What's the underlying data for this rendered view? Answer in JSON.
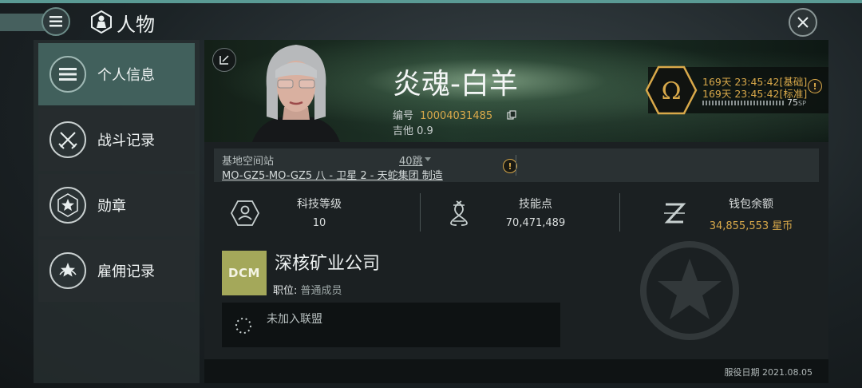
{
  "header": {
    "title": "人物"
  },
  "sidebar": {
    "items": [
      {
        "label": "个人信息",
        "icon": "list-icon",
        "active": true
      },
      {
        "label": "战斗记录",
        "icon": "crossed-swords-icon",
        "active": false
      },
      {
        "label": "勋章",
        "icon": "star-badge-icon",
        "active": false
      },
      {
        "label": "雇佣记录",
        "icon": "star-laurel-icon",
        "active": false
      }
    ]
  },
  "character": {
    "name": "炎魂-白羊",
    "id_label": "编号",
    "id_value": "10004031485",
    "security_label": "吉他",
    "security_value": "0.9"
  },
  "omega": {
    "time_basic": "169天 23:45:42[基础]",
    "time_standard": "169天 23:45:42[标准]",
    "sp_value": "75",
    "sp_unit": "SP"
  },
  "station": {
    "label": "基地空间站",
    "jumps": "40跳",
    "name": "MO-GZ5-MO-GZ5 八 - 卫星 2 - 天蛇集团 制造"
  },
  "stats": {
    "tech_level_label": "科技等级",
    "tech_level_value": "10",
    "skill_points_label": "技能点",
    "skill_points_value": "70,471,489",
    "wallet_label": "钱包余额",
    "wallet_value": "34,855,553 星币"
  },
  "corporation": {
    "logo_text": "DCM",
    "name": "深核矿业公司",
    "role_label": "职位:",
    "role_value": "普通成员"
  },
  "alliance": {
    "text": "未加入联盟"
  },
  "footer": {
    "service_date": "服役日期 2021.08.05"
  },
  "colors": {
    "accent_gold": "#d9a94a",
    "active_nav": "#41605c",
    "corp_logo_bg": "#a4a85a"
  }
}
